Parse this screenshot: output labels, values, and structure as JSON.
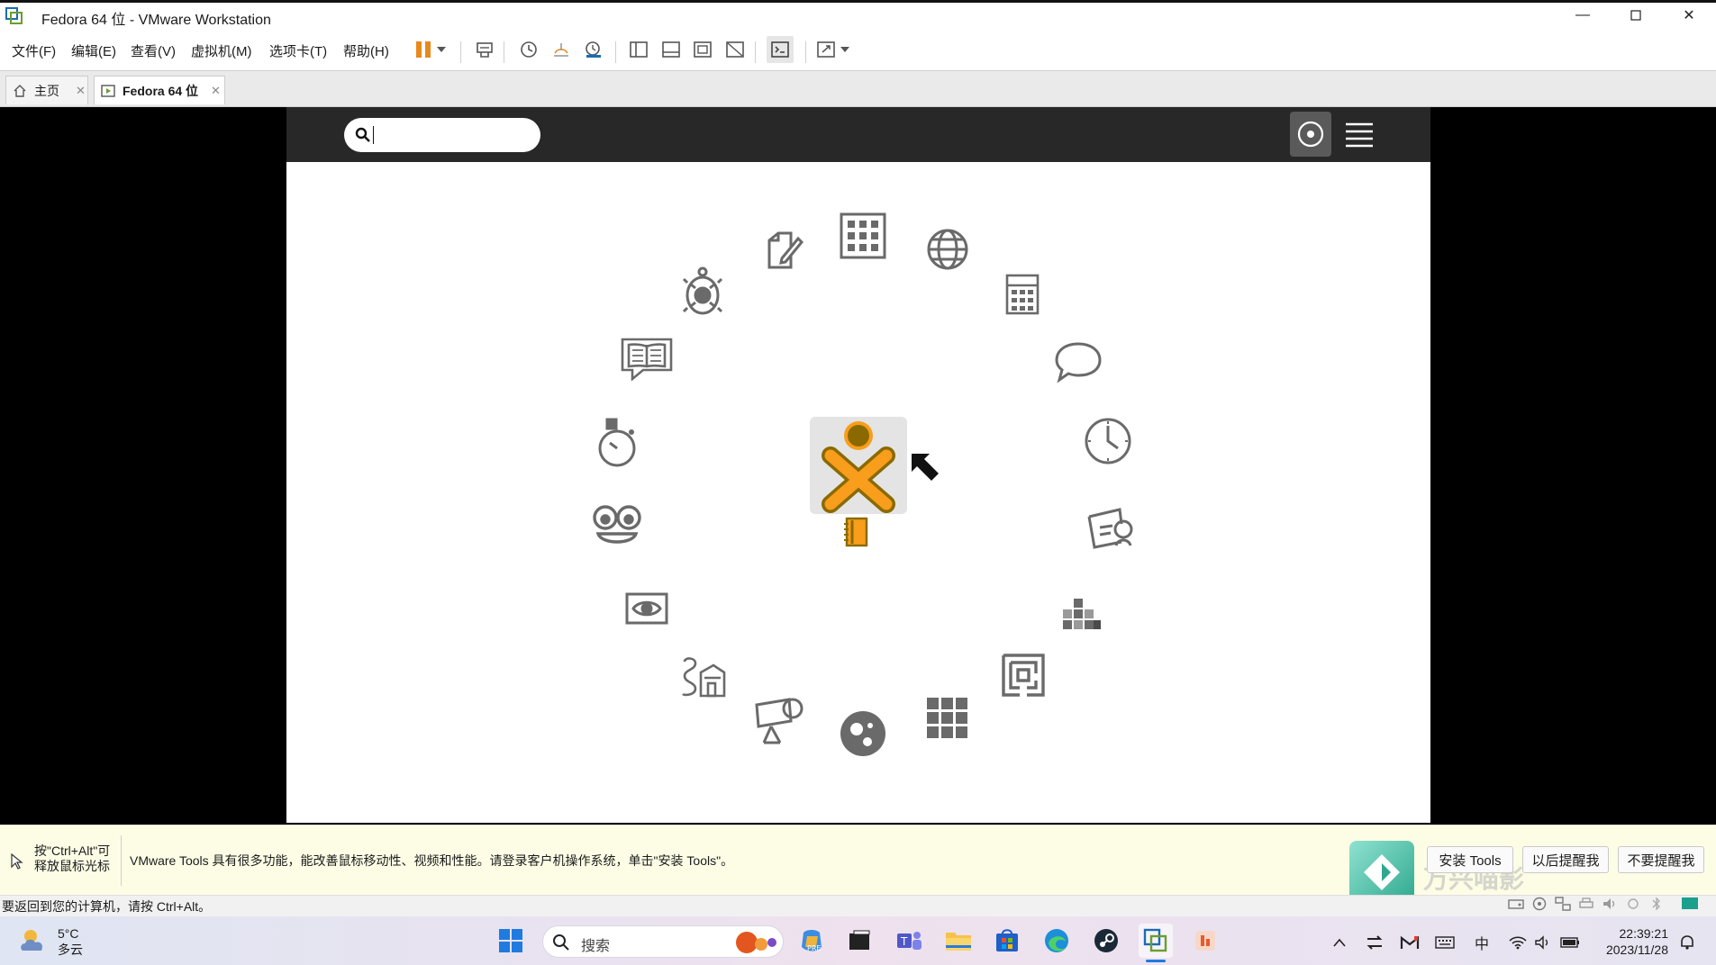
{
  "window": {
    "title": "Fedora 64 位 - VMware Workstation",
    "minimize_icon": "minimize-icon",
    "maximize_icon": "maximize-icon",
    "close_icon": "close-icon"
  },
  "menubar": {
    "items": [
      "文件(F)",
      "编辑(E)",
      "查看(V)",
      "虚拟机(M)",
      "选项卡(T)",
      "帮助(H)"
    ],
    "toolbar_icons": [
      "pause-icon",
      "dropdown-icon",
      "send-ctrl-alt-del-icon",
      "snapshot-icon",
      "revert-snapshot-icon",
      "snapshot-manager-icon",
      "show-library-icon",
      "thumbnail-bar-icon",
      "fullscreen-icon",
      "unity-icon",
      "console-view-icon",
      "stretch-icon",
      "dropdown-icon"
    ],
    "accent_color": "#e8891b"
  },
  "tabs": [
    {
      "label": "主页",
      "icon": "home-icon",
      "active": false
    },
    {
      "label": "Fedora 64 位",
      "icon": "vm-icon",
      "active": true
    }
  ],
  "guest": {
    "search_placeholder": "",
    "topbar_icons": [
      "search-icon",
      "home-view-icon",
      "list-view-icon"
    ],
    "activities": [
      "write-icon",
      "spreadsheet-icon",
      "browse-icon",
      "calculate-icon",
      "chat-icon",
      "clock-icon",
      "portfolio-icon",
      "blocks-icon",
      "maze-icon",
      "memorize-icon",
      "physics-icon",
      "imageviewer-icon",
      "abacus-icon",
      "turtle-icon",
      "read-icon",
      "speak-icon",
      "stopwatch-icon",
      "record-icon",
      "turtleblocks-icon",
      "journal-icon"
    ],
    "center_icon": "xo-buddy-icon",
    "journal_icon": "journal-icon",
    "cursor_icon": "mouse-pointer-icon",
    "xo_fill": "#f89d1c",
    "xo_stroke": "#8a6a00"
  },
  "infobar": {
    "hint_line1": "按\"Ctrl+Alt\"可",
    "hint_line2": "释放鼠标光标",
    "message": "VMware Tools 具有很多功能，能改善鼠标移动性、视频和性能。请登录客户机操作系统，单击\"安装 Tools\"。",
    "install_button": "安装 Tools",
    "remind_later_button": "以后提醒我",
    "never_remind_button": "不要提醒我",
    "watermark": "万兴喵影"
  },
  "statusbar": {
    "text": "要返回到您的计算机，请按 Ctrl+Alt。",
    "device_icons": [
      "hard-disk-icon",
      "cdrom-icon",
      "network-icon",
      "printer-icon",
      "sound-icon",
      "usb-icon",
      "bluetooth-icon",
      "message-icon"
    ]
  },
  "taskbar": {
    "weather_temp": "5°C",
    "weather_desc": "多云",
    "search_placeholder": "搜索",
    "apps": [
      "windows-start-icon",
      "copilot-icon",
      "terminal-icon",
      "teams-icon",
      "file-explorer-icon",
      "store-icon",
      "edge-icon",
      "steam-icon",
      "vmware-icon",
      "wondershare-icon"
    ],
    "tray_icons": [
      "chevron-up-icon",
      "transfer-icon",
      "gmail-icon",
      "keyboard-icon",
      "wifi-icon",
      "volume-icon",
      "battery-icon",
      "notification-icon"
    ],
    "ime": "中",
    "time": "22:39:21",
    "date": "2023/11/28"
  }
}
